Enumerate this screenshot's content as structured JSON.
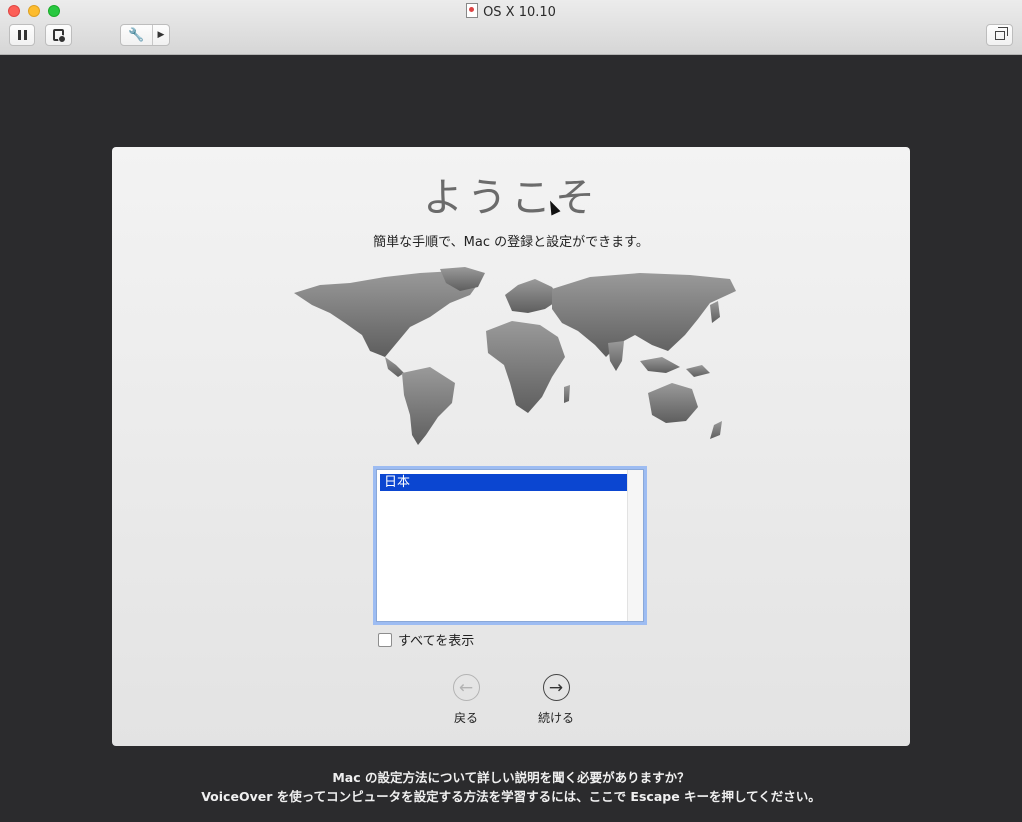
{
  "window": {
    "title": "OS X 10.10"
  },
  "toolbar": {
    "buttons": [
      {
        "name": "pause",
        "icon": "pause-icon"
      },
      {
        "name": "snapshot",
        "icon": "snapshot-icon"
      },
      {
        "name": "settings",
        "icon": "wrench-icon",
        "has_menu": true
      },
      {
        "name": "fullscreen",
        "icon": "restore-window-icon"
      }
    ]
  },
  "setup": {
    "welcome": "ようこそ",
    "subtitle": "簡単な手順で、Mac の登録と設定ができます。",
    "country_list": {
      "items": [
        "日本"
      ],
      "selected": "日本"
    },
    "show_all_label": "すべてを表示",
    "back_label": "戻る",
    "continue_label": "続ける"
  },
  "footer": {
    "line1": "Mac の設定方法について詳しい説明を聞く必要がありますか？",
    "line2": "VoiceOver を使ってコンピュータを設定する方法を学習するには、ここで Escape キーを押してください。"
  },
  "colors": {
    "background": "#2b2b2d",
    "selection": "#0b46d1",
    "focus_ring": "#9dbcf2"
  }
}
